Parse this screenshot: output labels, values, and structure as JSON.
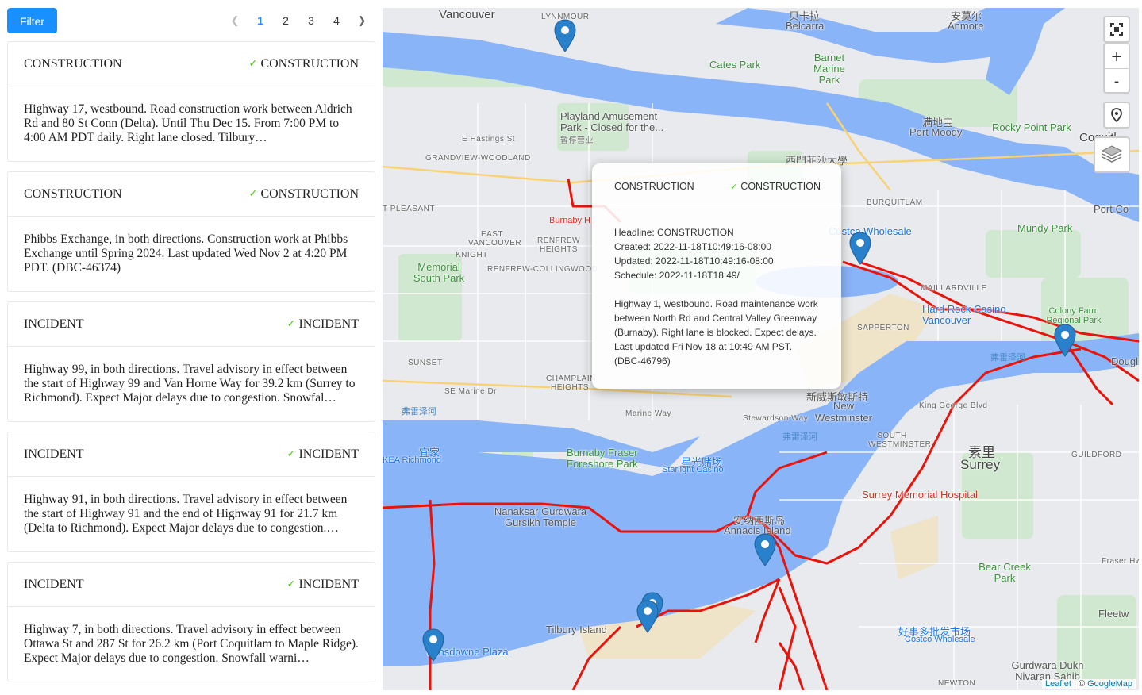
{
  "toolbar": {
    "filter_label": "Filter"
  },
  "pagination": {
    "pages": [
      "1",
      "2",
      "3",
      "4"
    ],
    "current": "1",
    "prev_icon": "chevron-left",
    "next_icon": "chevron-right"
  },
  "cards": [
    {
      "title": "CONSTRUCTION",
      "tag": "CONSTRUCTION",
      "body": "Highway 17, westbound. Road construction work between Aldrich Rd and 80 St Conn (Delta). Until Thu Dec 15. From 7:00 PM to 4:00 AM PDT daily. Right lane closed. Tilbury…"
    },
    {
      "title": "CONSTRUCTION",
      "tag": "CONSTRUCTION",
      "body": "Phibbs Exchange, in both directions. Construction work at Phibbs Exchange until Spring 2024. Last updated Wed Nov 2 at 4:20 PM PDT. (DBC-46374)"
    },
    {
      "title": "INCIDENT",
      "tag": "INCIDENT",
      "body": "Highway 99, in both directions. Travel advisory in effect between the start of Highway 99 and Van Horne Way for 39.2 km (Surrey to Richmond). Expect Major delays due to congestion. Snowfal…"
    },
    {
      "title": "INCIDENT",
      "tag": "INCIDENT",
      "body": "Highway 91, in both directions. Travel advisory in effect between the start of Highway 91 and the end of Highway 91 for 21.7 km (Delta to Richmond). Expect Major delays due to congestion.…"
    },
    {
      "title": "INCIDENT",
      "tag": "INCIDENT",
      "body": "Highway 7, in both directions. Travel advisory in effect between Ottawa St and 287 St for 26.2 km (Port Coquitlam to Maple Ridge). Expect Major delays due to congestion. Snowfall warni…"
    }
  ],
  "map": {
    "labels": {
      "vancouver": "Vancouver",
      "lynnmour": "LYNNMOUR",
      "belcarra_cn": "贝卡拉",
      "belcarra": "Belcarra",
      "anmore_cn": "安莫尔",
      "anmore": "Anmore",
      "cates_park": "Cates Park",
      "barnet_park": "Barnet Marine Park",
      "playland": "Playland Amusement Park - Closed for the...",
      "playland_cn": "暂停营业",
      "hastings": "E Hastings St",
      "grandview": "GRANDVIEW-WOODLAND",
      "sfu_cn": "西門菲沙大學",
      "port_moody_cn": "满地宝",
      "port_moody": "Port Moody",
      "rocky_point": "Rocky Point Park",
      "coquitlam": "Coquitl",
      "burquitlam": "BURQUITLAM",
      "costco": "Costco Wholesale",
      "mundy_park": "Mundy Park",
      "port_coq": "Port Co",
      "memorial_park": "Memorial South Park",
      "mount_pleasant": "T PLEASANT",
      "east_van": "EAST VANCOUVER",
      "renfrew": "RENFREW HEIGHTS",
      "knight": "KNIGHT",
      "renfrew_coll": "RENFREW-COLLINGWOOD",
      "burnaby_hosp": "Burnaby H",
      "maillardville": "MAILLARDVILLE",
      "hard_rock": "Hard Rock Casino Vancouver",
      "colony_farm": "Colony Farm Regional Park",
      "sapperton": "SAPPERTON",
      "douglas": "Dougl",
      "sunset": "SUNSET",
      "champlain": "CHAMPLAIN HEIGHTS",
      "se_marine": "SE Marine Dr",
      "marine_way": "Marine Way",
      "new_west_cn": "新威斯敏斯特",
      "new_west": "New Westminster",
      "king_george": "King George Blvd",
      "ikea": "KEA Richmond",
      "ikea_cn": "宜家",
      "burnaby_fraser": "Burnaby Fraser Foreshore Park",
      "starlight": "Starlight Casino",
      "starlight_cn": "星光赌场",
      "south_west": "SOUTH WESTMINSTER",
      "surrey_cn": "素里",
      "surrey": "Surrey",
      "guildford": "GUILDFORD",
      "surrey_hosp": "Surrey Memorial Hospital",
      "nanaksar": "Nanaksar Gurdwara Gursikh Temple",
      "annacis_cn": "安纳西斯岛",
      "annacis": "Annacis Island",
      "bear_creek": "Bear Creek Park",
      "fraser_hwy": "Fraser Hwy",
      "tilbury": "Tilbury Island",
      "lansdowne": "Lansdowne Plaza",
      "costco_whole_cn": "好事多批发市场",
      "costco_whole": "Costco Wholesale",
      "fleetwood": "Fleetw",
      "gurdwara": "Gurdwara Dukh Nivaran Sahib",
      "newton": "NEWTON",
      "fraser_river": "弗雷泽河",
      "stewardson": "Stewardson Way"
    },
    "popup": {
      "title": "CONSTRUCTION",
      "tag": "CONSTRUCTION",
      "headline": "Headline: CONSTRUCTION",
      "created": "Created: 2022-11-18T10:49:16-08:00",
      "updated": "Updated: 2022-11-18T10:49:16-08:00",
      "schedule": "Schedule: 2022-11-18T18:49/",
      "description": "Highway 1, westbound. Road maintenance work between North Rd and Central Valley Greenway (Burnaby). Right lane is blocked. Expect delays. Last updated Fri Nov 18 at 10:49 AM PST. (DBC-46796)"
    },
    "controls": {
      "fullscreen_icon": "fullscreen-icon",
      "zoom_in": "+",
      "zoom_out": "-",
      "locate_icon": "location-pin-icon",
      "layers_icon": "layers-icon"
    },
    "attribution": {
      "leaflet": "Leaflet",
      "separator": " | © ",
      "provider": "GoogleMap"
    },
    "colors": {
      "water": "#8ab4f8",
      "land": "#e8eaed",
      "park": "#c8e6c9",
      "route": "#e8140c",
      "marker": "#2a81cb"
    }
  }
}
